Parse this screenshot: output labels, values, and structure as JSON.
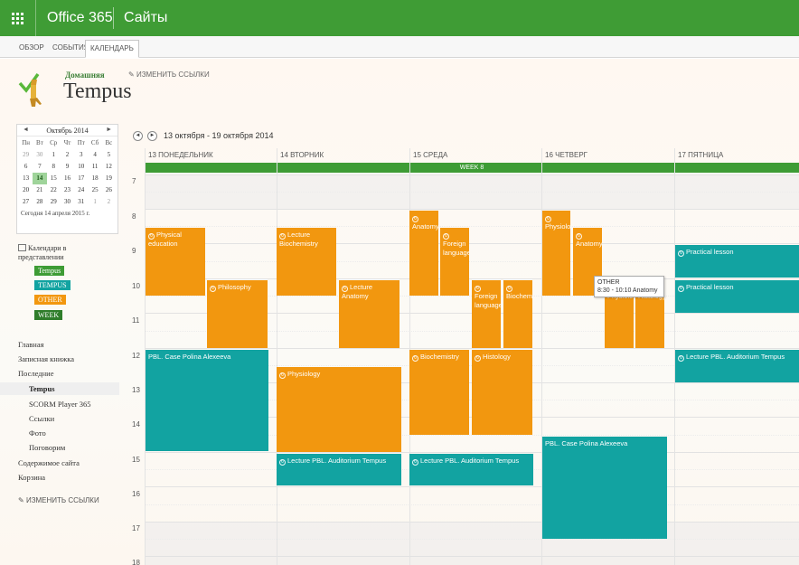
{
  "suite": {
    "brand": "Office 365",
    "sites": "Сайты"
  },
  "ribbon": {
    "tabs": [
      "ОБЗОР",
      "СОБЫТИЯ",
      "КАЛЕНДАРЬ"
    ]
  },
  "header": {
    "home_link": "Домашняя",
    "edit_links": "ИЗМЕНИТЬ ССЫЛКИ",
    "site_title": "Tempus"
  },
  "datepicker": {
    "prev": "◄",
    "next": "►",
    "month": "Октябрь 2014",
    "dow": [
      "Пн",
      "Вт",
      "Ср",
      "Чт",
      "Пт",
      "Сб",
      "Вс"
    ],
    "weeks": [
      [
        "29",
        "30",
        "1",
        "2",
        "3",
        "4",
        "5"
      ],
      [
        "6",
        "7",
        "8",
        "9",
        "10",
        "11",
        "12"
      ],
      [
        "13",
        "14",
        "15",
        "16",
        "17",
        "18",
        "19"
      ],
      [
        "20",
        "21",
        "22",
        "23",
        "24",
        "25",
        "26"
      ],
      [
        "27",
        "28",
        "29",
        "30",
        "31",
        "1",
        "2"
      ]
    ],
    "selected_day": "14",
    "today_text": "Сегодня 14 апреля 2015 г."
  },
  "calendars_in_view": {
    "title": "Календари в представлении",
    "items": [
      {
        "label": "Tempus",
        "color": "#3e9c35"
      },
      {
        "label": "TEMPUS",
        "color": "#12a3a1"
      },
      {
        "label": "OTHER",
        "color": "#f2970f"
      },
      {
        "label": "WEEK",
        "color": "#2f7d2b"
      }
    ]
  },
  "quicklaunch": {
    "items": [
      "Главная",
      "Записная книжка",
      "Последние",
      "Tempus",
      "SCORM Player 365",
      "Ссылки",
      "Фото",
      "Поговорим",
      "Содержимое сайта",
      "Корзина"
    ],
    "edit_links": "ИЗМЕНИТЬ ССЫЛКИ"
  },
  "calendar": {
    "prev": "◄",
    "next": "►",
    "range": "13 октября - 19 октября 2014",
    "days": [
      "13 ПОНЕДЕЛЬНИК",
      "14 ВТОРНИК",
      "15 СРЕДА",
      "16 ЧЕТВЕРГ",
      "17 ПЯТНИЦА"
    ],
    "week_label": "WEEK 8",
    "hours": [
      "7",
      "8",
      "9",
      "10",
      "11",
      "12",
      "13",
      "14",
      "15",
      "16",
      "17",
      "18"
    ],
    "events": [
      {
        "title": "Physical education",
        "recurring": true
      },
      {
        "title": "Philosophy",
        "recurring": true
      },
      {
        "title": "PBL. Case Polina Alexeeva",
        "recurring": false
      },
      {
        "title": "Lecture Biochemistry",
        "recurring": true
      },
      {
        "title": "Lecture Anatomy",
        "recurring": true
      },
      {
        "title": "Physiology",
        "recurring": true
      },
      {
        "title": "Lecture PBL. Auditorium Tempus",
        "recurring": true
      },
      {
        "title": "Anatomy",
        "recurring": true
      },
      {
        "title": "Foreign language",
        "recurring": true
      },
      {
        "title": "Foreign language",
        "recurring": true
      },
      {
        "title": "Biochemistry",
        "recurring": true
      },
      {
        "title": "Biochemistry",
        "recurring": true
      },
      {
        "title": "Histology",
        "recurring": true
      },
      {
        "title": "Lecture PBL. Auditorium Tempus",
        "recurring": true
      },
      {
        "title": "Physiology",
        "recurring": true
      },
      {
        "title": "Anatomy",
        "recurring": true
      },
      {
        "title": "Physiology",
        "recurring": true
      },
      {
        "title": "Histology",
        "recurring": true
      },
      {
        "title": "PBL. Case Polina Alexeeva",
        "recurring": false
      },
      {
        "title": "Practical lesson",
        "recurring": true
      },
      {
        "title": "Practical lesson",
        "recurring": true
      },
      {
        "title": "Lecture PBL. Auditorium Tempus",
        "recurring": true
      }
    ],
    "tooltip": {
      "category": "OTHER",
      "detail": "8:30 - 10:10 Anatomy"
    }
  }
}
